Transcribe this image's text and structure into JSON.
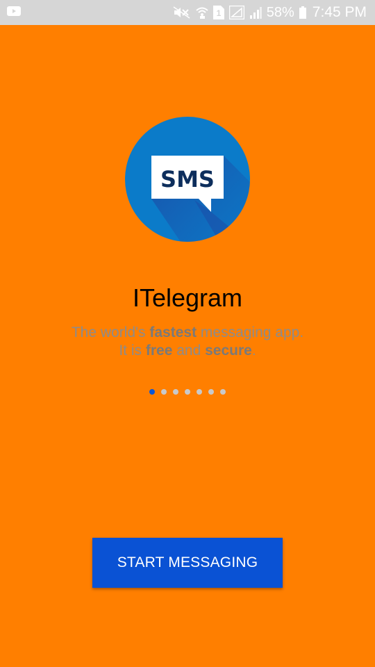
{
  "status_bar": {
    "battery_percent": "58%",
    "time": "7:45 PM",
    "sim_label": "1",
    "icons": [
      "youtube-icon",
      "mute-icon",
      "wifi-icon",
      "sim-icon",
      "signal-icon",
      "signal-icon",
      "battery-icon"
    ]
  },
  "logo": {
    "text": "SMS",
    "circle_color": "#0B7BC9",
    "shadow_color": "#1A4FA8",
    "bubble_text_color": "#0D2E5C"
  },
  "title": "ITelegram",
  "tagline": {
    "line1_pre": "The world's ",
    "line1_bold": "fastest",
    "line1_post": " messaging app.",
    "line2_pre": "It is ",
    "line2_bold1": "free",
    "line2_mid": " and ",
    "line2_bold2": "secure",
    "line2_post": "."
  },
  "pager": {
    "count": 7,
    "active_index": 0,
    "active_color": "#0A56D8",
    "inactive_color": "#C9C9C9"
  },
  "start_button": {
    "label": "START MESSAGING",
    "color": "#0A52D4"
  },
  "colors": {
    "background": "#FF7F00",
    "status_bar": "#D6D6D6"
  }
}
